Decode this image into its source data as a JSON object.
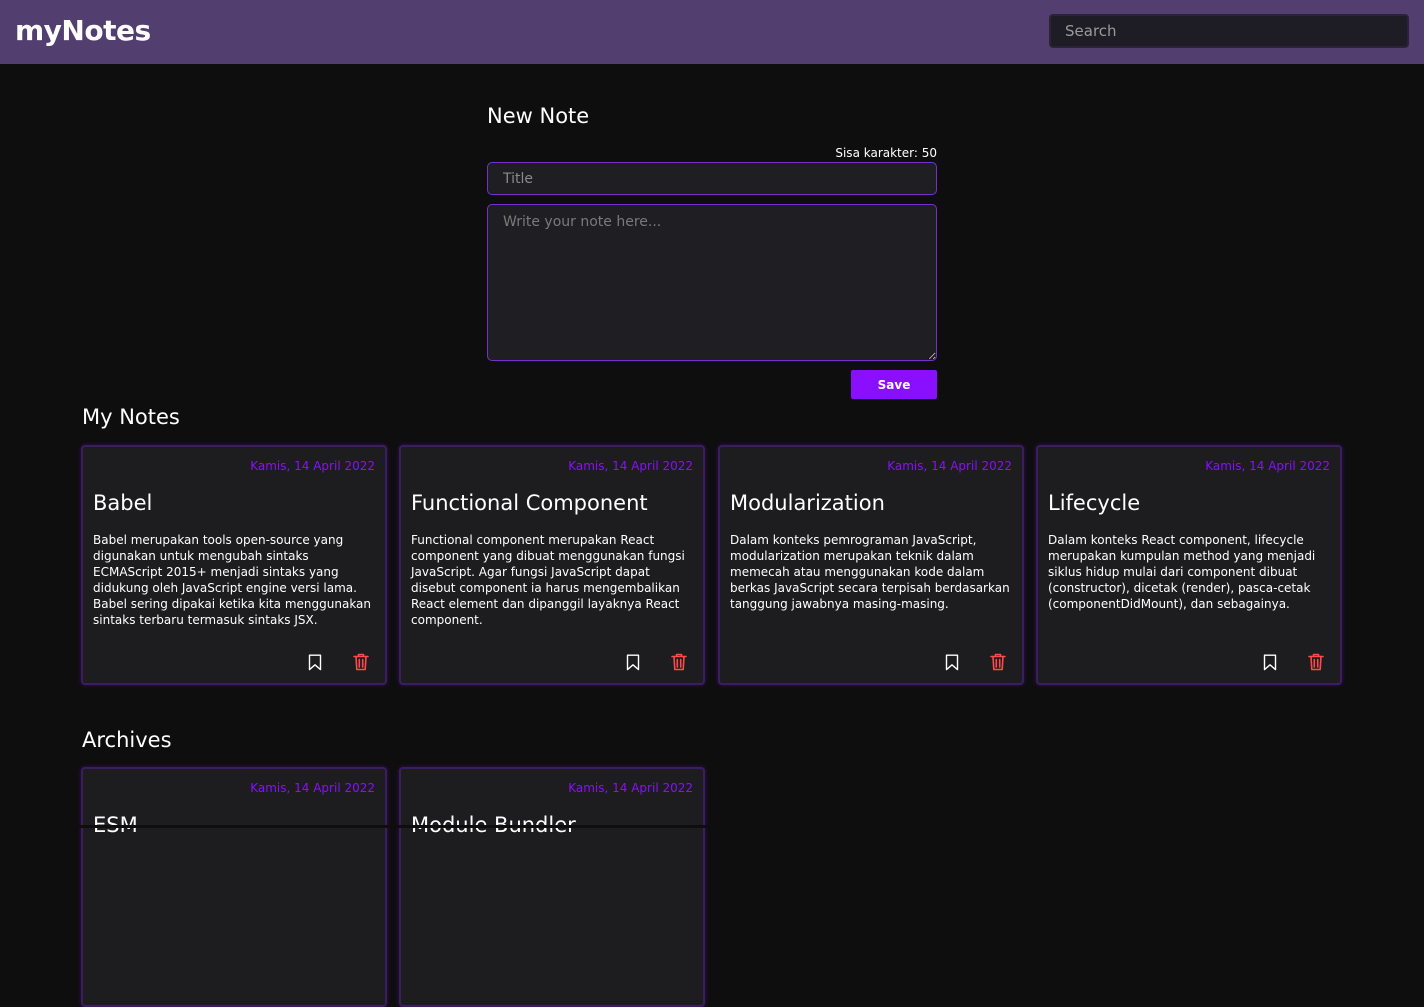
{
  "app": {
    "logo": "myNotes",
    "search_placeholder": "Search"
  },
  "form": {
    "heading": "New Note",
    "char_counter": "Sisa karakter: 50",
    "title_placeholder": "Title",
    "body_placeholder": "Write your note here...",
    "save_label": "Save"
  },
  "sections": {
    "notes_heading": "My Notes",
    "archives_heading": "Archives"
  },
  "colors": {
    "header_bg": "#523e6f",
    "accent": "#8a0fff",
    "delete": "#ff4a4a"
  },
  "notes": [
    {
      "date": "Kamis, 14 April 2022",
      "title": "Babel",
      "body": "Babel merupakan tools open-source yang digunakan untuk mengubah sintaks ECMAScript 2015+ menjadi sintaks yang didukung oleh JavaScript engine versi lama. Babel sering dipakai ketika kita menggunakan sintaks terbaru termasuk sintaks JSX."
    },
    {
      "date": "Kamis, 14 April 2022",
      "title": "Functional Component",
      "body": "Functional component merupakan React component yang dibuat menggunakan fungsi JavaScript. Agar fungsi JavaScript dapat disebut component ia harus mengembalikan React element dan dipanggil layaknya React component."
    },
    {
      "date": "Kamis, 14 April 2022",
      "title": "Modularization",
      "body": "Dalam konteks pemrograman JavaScript, modularization merupakan teknik dalam memecah atau menggunakan kode dalam berkas JavaScript secara terpisah berdasarkan tanggung jawabnya masing-masing."
    },
    {
      "date": "Kamis, 14 April 2022",
      "title": "Lifecycle",
      "body": "Dalam konteks React component, lifecycle merupakan kumpulan method yang menjadi siklus hidup mulai dari component dibuat (constructor), dicetak (render), pasca-cetak (componentDidMount), dan sebagainya."
    }
  ],
  "archives": [
    {
      "date": "Kamis, 14 April 2022",
      "title": "ESM"
    },
    {
      "date": "Kamis, 14 April 2022",
      "title": "Module Bundler"
    }
  ],
  "icons": {
    "bookmark": "bookmark-icon",
    "delete": "trash-icon"
  }
}
